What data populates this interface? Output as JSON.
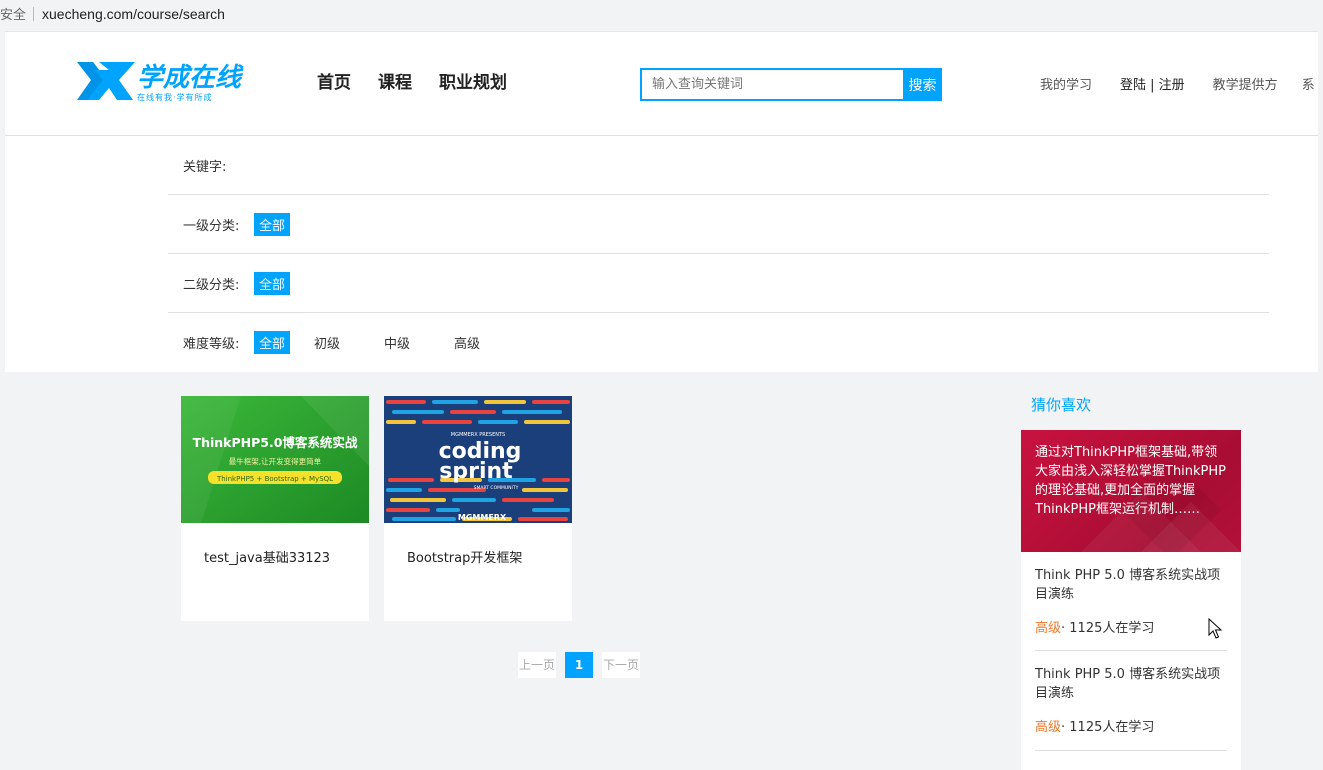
{
  "browser": {
    "security_label": "安全",
    "url": "xuecheng.com/course/search"
  },
  "header": {
    "logo_text": "学成在线",
    "logo_slogan": "在线有我·学有所成",
    "nav": [
      "首页",
      "课程",
      "职业规划"
    ],
    "search": {
      "placeholder": "输入查询关键词",
      "button_label": "搜索"
    },
    "links": {
      "my_learning": "我的学习",
      "login_register": "登陆 | 注册",
      "provider": "教学提供方",
      "system": "系"
    }
  },
  "filters": {
    "keyword_label": "关键字:",
    "level1": {
      "label": "一级分类:",
      "options": [
        "全部"
      ]
    },
    "level2": {
      "label": "二级分类:",
      "options": [
        "全部"
      ]
    },
    "difficulty": {
      "label": "难度等级:",
      "options": [
        "全部",
        "初级",
        "中级",
        "高级"
      ]
    }
  },
  "courses": [
    {
      "title": "test_java基础33123",
      "thumb_title": "ThinkPHP5.0博客系统实战",
      "thumb_sub": "最牛框架,让开发变得更简单",
      "thumb_badge": "ThinkPHP5 + Bootstrap + MySQL"
    },
    {
      "title": "Bootstrap开发框架",
      "thumb_top": "MGMMERX PRESENTS",
      "thumb_line1": "coding",
      "thumb_line2": "sprint",
      "thumb_community": "SMART COMMUNITY",
      "thumb_brand": "MGMMERX"
    }
  ],
  "pagination": {
    "prev": "上一页",
    "current": "1",
    "next": "下一页"
  },
  "recommend": {
    "title": "猜你喜欢",
    "banner_text": "通过对ThinkPHP框架基础,带领大家由浅入深轻松掌握ThinkPHP的理论基础,更加全面的掌握ThinkPHP框架运行机制……",
    "items": [
      {
        "name": "Think PHP 5.0 博客系统实战项目演练",
        "level": "高级",
        "learners": "· 1125人在学习"
      },
      {
        "name": "Think PHP 5.0 博客系统实战项目演练",
        "level": "高级",
        "learners": "· 1125人在学习"
      }
    ]
  },
  "colors": {
    "accent": "#00a4ff",
    "level_orange": "#f0782b",
    "banner_red": "#c8123f"
  }
}
